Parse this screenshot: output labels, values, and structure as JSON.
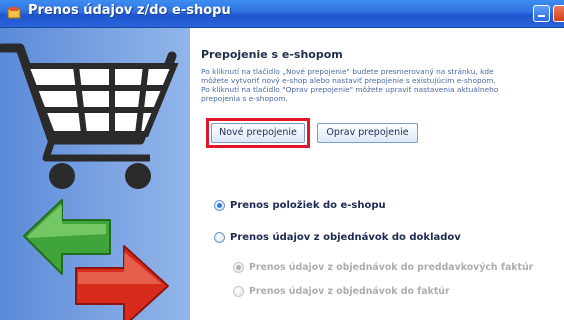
{
  "window": {
    "title": "Prenos údajov z/do e-shopu",
    "icons": {
      "app": "app-icon",
      "minimize": "minimize-icon",
      "close": "close-icon"
    }
  },
  "sidebar": {
    "illustration": [
      "shopping-cart-icon",
      "green-arrow-left-icon",
      "red-arrow-right-icon"
    ]
  },
  "section": {
    "heading": "Prepojenie s e-shopom",
    "description_lines": [
      "Po kliknutí na tlačidlo „Nové prepojenie\" budete presmerovaný na stránku, kde",
      "môžete vytvoriť nový e-shop alebo nastaviť prepojenie s existujúcim e-shopom.",
      "Po kliknutí na tlačidlo \"Oprav prepojenie\" môžete upraviť nastavenia aktuálneho",
      "prepojenia s e-shopom."
    ]
  },
  "buttons": {
    "new_connection": "Nové prepojenie",
    "fix_connection": "Oprav prepojenie"
  },
  "options": {
    "transfer_items": {
      "label": "Prenos položiek do e-shopu",
      "selected": true
    },
    "transfer_orders": {
      "label": "Prenos údajov z objednávok do dokladov",
      "selected": false
    },
    "to_advance_invoices": {
      "label": "Prenos údajov z objednávok do preddavkových faktúr",
      "selected": true,
      "enabled": false
    },
    "to_invoices": {
      "label": "Prenos údajov z objednávok do faktúr",
      "selected": false,
      "enabled": false
    }
  },
  "colors": {
    "titlebar": "#2f6fe0",
    "sidebar": "#6d98dd",
    "highlight": "#e0172a",
    "heading": "#22304e",
    "description": "#4a6aa8"
  }
}
